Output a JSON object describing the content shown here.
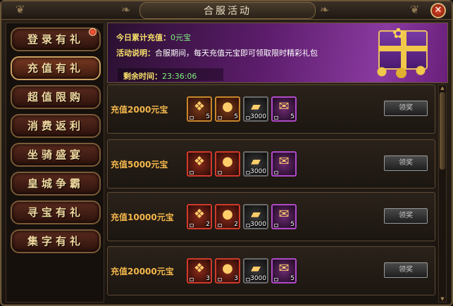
{
  "window": {
    "title": "合服活动",
    "close_glyph": "✕"
  },
  "sidebar": {
    "items": [
      {
        "label": "登录有礼",
        "badge": true
      },
      {
        "label": "充值有礼",
        "active": true
      },
      {
        "label": "超值限购"
      },
      {
        "label": "消费返利"
      },
      {
        "label": "坐骑盛宴"
      },
      {
        "label": "皇城争霸"
      },
      {
        "label": "寻宝有礼"
      },
      {
        "label": "集字有礼"
      }
    ]
  },
  "banner": {
    "today_key": "今日累计充值：",
    "today_val": "0元宝",
    "desc_key": "活动说明：",
    "desc_val": "合服期间，每天充值元宝即可领取限时精彩礼包",
    "timer_key": "剩余时间：",
    "timer_val": "23:36:06"
  },
  "rows": [
    {
      "label": "充值2000元宝",
      "counts": [
        "5",
        "5",
        "3000",
        "5"
      ],
      "button": "领奖"
    },
    {
      "label": "充值5000元宝",
      "counts": [
        "",
        "",
        "3000",
        ""
      ],
      "button": "领奖"
    },
    {
      "label": "充值10000元宝",
      "counts": [
        "2",
        "2",
        "3000",
        "5"
      ],
      "button": "领奖"
    },
    {
      "label": "充值20000元宝",
      "counts": [
        "3",
        "3",
        "3000",
        "5"
      ],
      "button": "领奖"
    }
  ],
  "icons": [
    "crystal-icon",
    "orb-icon",
    "gold-ingot-icon",
    "scroll-bag-icon"
  ],
  "colors": {
    "accent": "#f3b64b",
    "banner_purple": "#5b1c6a",
    "frame": "#6b5637"
  }
}
